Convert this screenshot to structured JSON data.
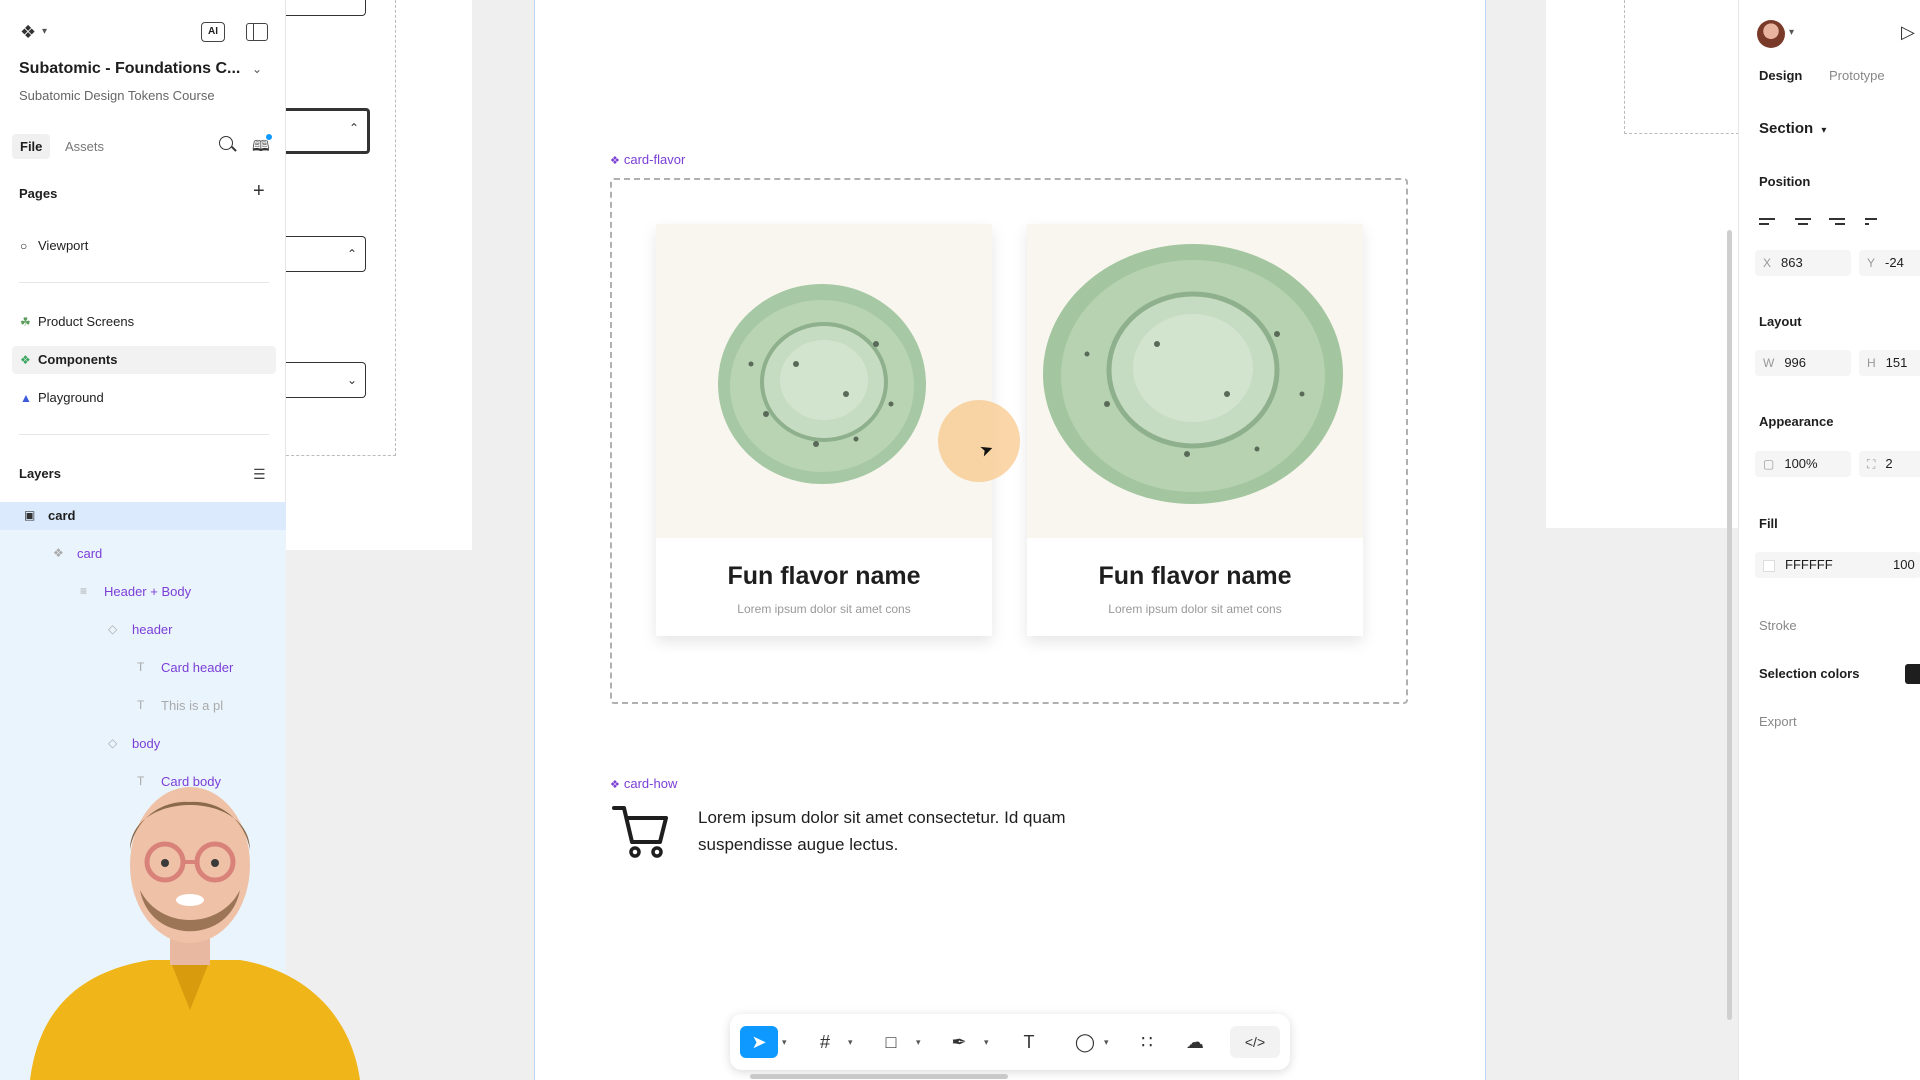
{
  "file": {
    "title": "Subatomic - Foundations C...",
    "subtitle": "Subatomic Design Tokens Course",
    "tabs": {
      "file": "File",
      "assets": "Assets"
    }
  },
  "ai_badge": "AI",
  "pages": {
    "header": "Pages",
    "items": [
      {
        "label": "Viewport",
        "icon": "circle-icon"
      },
      {
        "label": "Product Screens",
        "icon": "leaf-icon"
      },
      {
        "label": "Components",
        "icon": "puzzle-icon"
      },
      {
        "label": "Playground",
        "icon": "shapes-icon"
      }
    ]
  },
  "layers": {
    "header": "Layers",
    "items": [
      {
        "label": "card",
        "type": "frame"
      },
      {
        "label": "card",
        "type": "component"
      },
      {
        "label": "Header + Body",
        "type": "autolayout"
      },
      {
        "label": "header",
        "type": "instance"
      },
      {
        "label": "Card header",
        "type": "text"
      },
      {
        "label": "This is a pl",
        "type": "text"
      },
      {
        "label": "body",
        "type": "instance"
      },
      {
        "label": "Card body",
        "type": "text"
      }
    ]
  },
  "canvas": {
    "card_flavor_label": "card-flavor",
    "cards": [
      {
        "title": "Fun flavor name",
        "subtitle": "Lorem ipsum dolor sit amet cons"
      },
      {
        "title": "Fun flavor name",
        "subtitle": "Lorem ipsum dolor sit amet cons"
      }
    ],
    "card_how_label": "card-how",
    "how_text": "Lorem ipsum dolor sit amet consectetur. Id quam suspendisse augue lectus."
  },
  "toolbar": {
    "items": [
      "move-tool",
      "frame-tool",
      "shape-tool",
      "pen-tool",
      "text-tool",
      "comment-tool",
      "actions-tool",
      "ai-tool",
      "dev-mode-toggle"
    ],
    "active": "move-tool"
  },
  "design_panel": {
    "tabs": {
      "design": "Design",
      "prototype": "Prototype"
    },
    "section_label": "Section",
    "position": {
      "header": "Position",
      "x_label": "X",
      "x": "863",
      "y_label": "Y",
      "y": "-24"
    },
    "layout": {
      "header": "Layout",
      "w_label": "W",
      "w": "996",
      "h_label": "H",
      "h": "151"
    },
    "appearance": {
      "header": "Appearance",
      "opacity": "100%",
      "radius": "2"
    },
    "fill": {
      "header": "Fill",
      "hex": "FFFFFF",
      "opacity": "100"
    },
    "stroke": {
      "header": "Stroke"
    },
    "selection_colors": {
      "header": "Selection colors",
      "color": "#1e1e1e"
    },
    "export": {
      "header": "Export"
    }
  },
  "colors": {
    "accent": "#0d99ff",
    "component": "#7b3fd6",
    "layer_highlight": "#eaf4fd"
  }
}
